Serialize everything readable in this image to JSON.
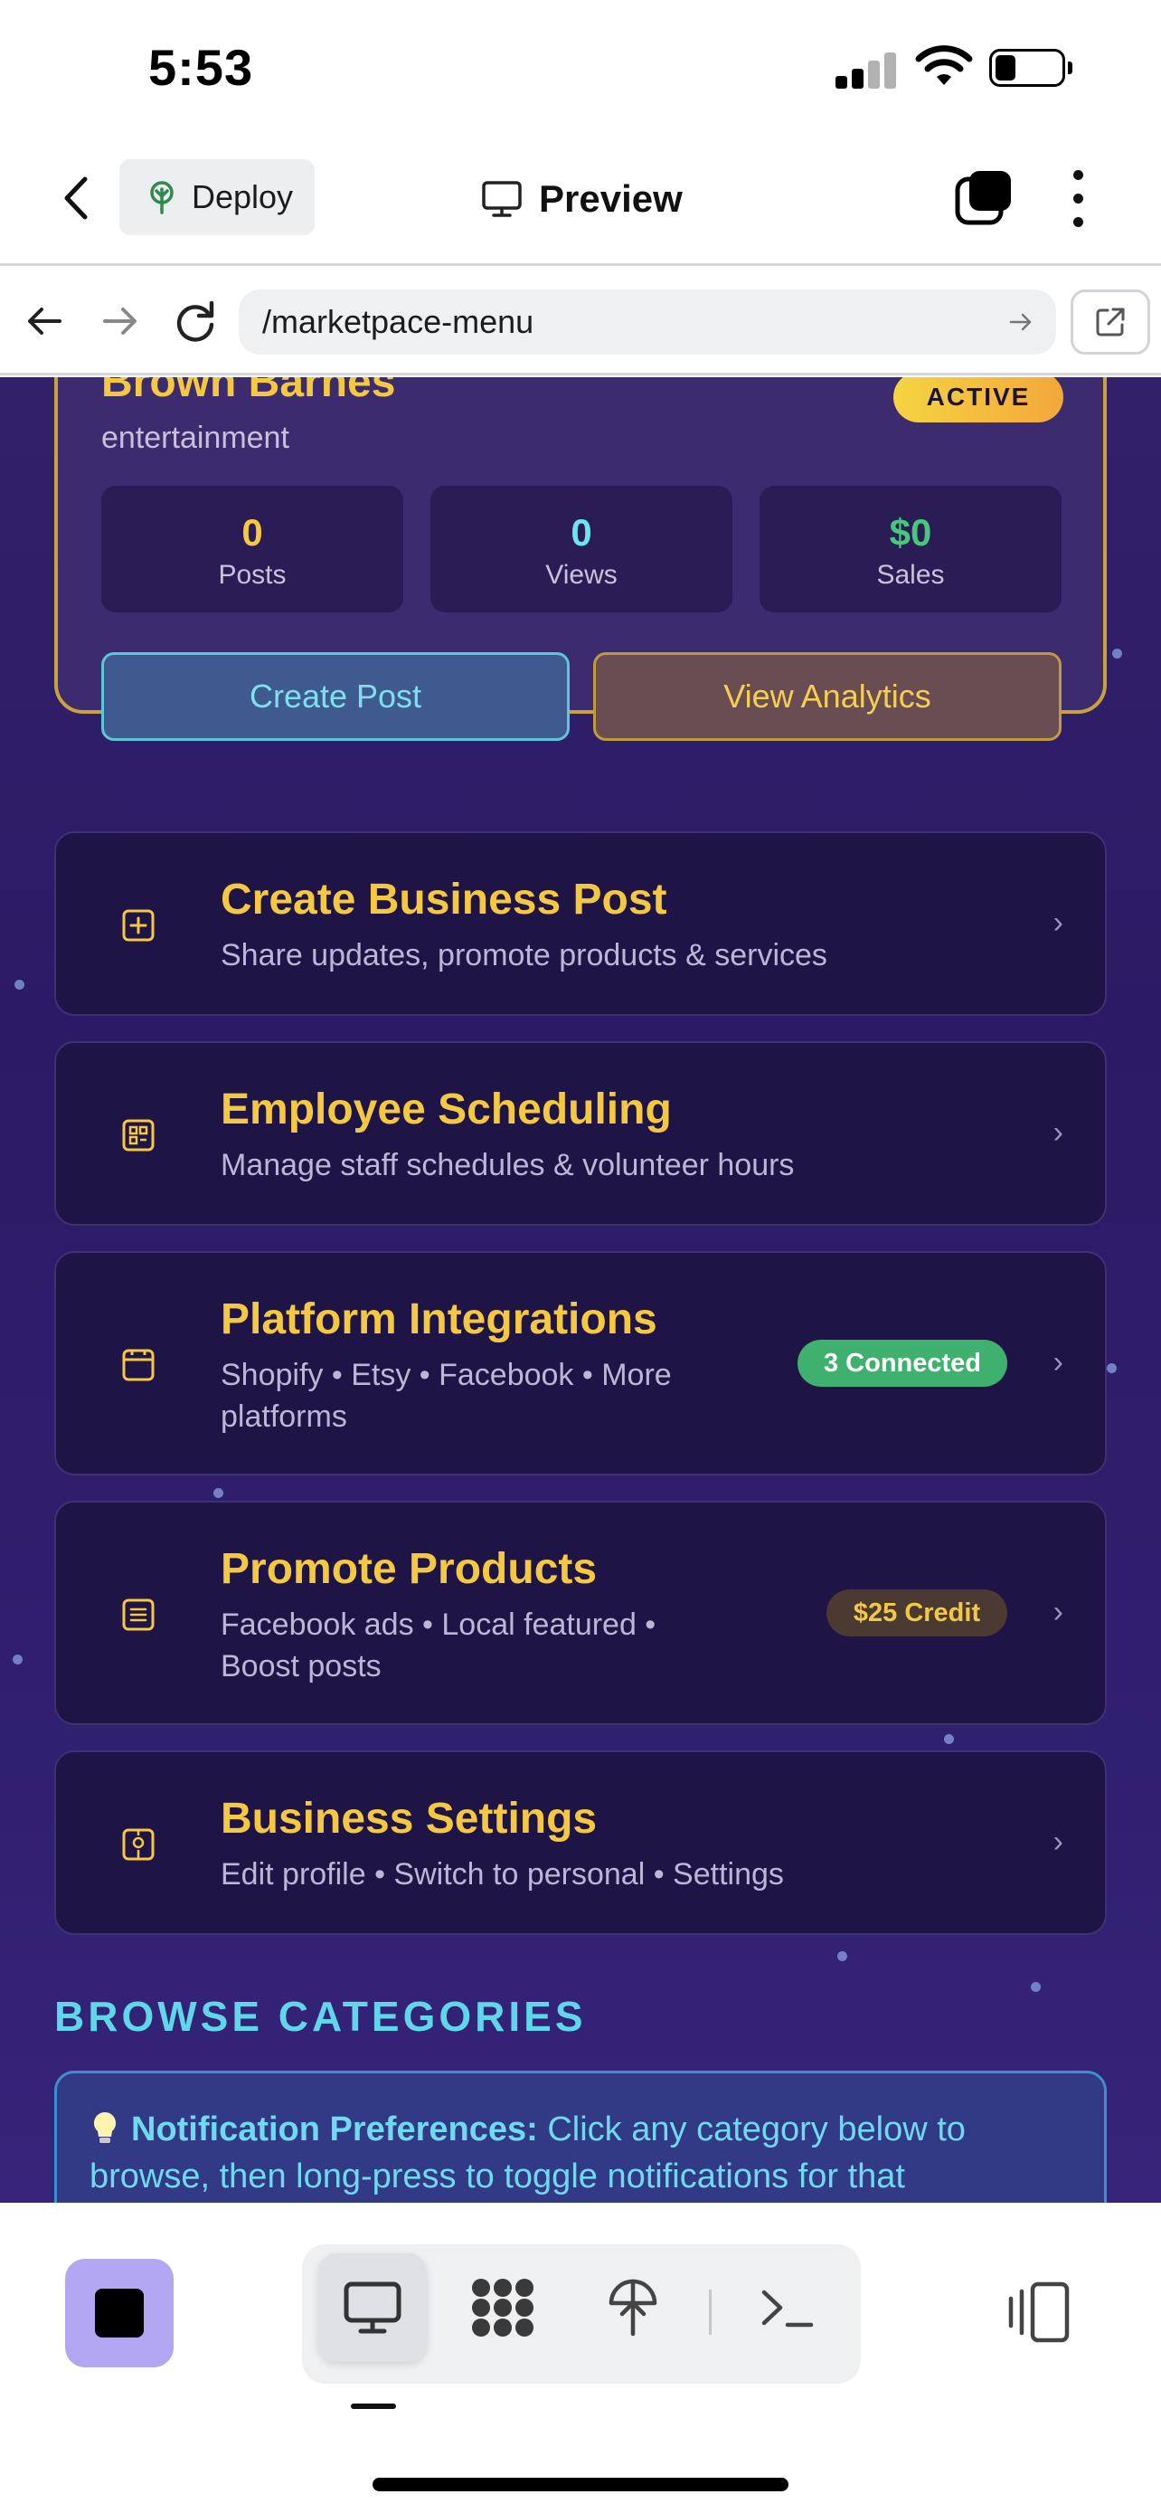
{
  "status_bar": {
    "time": "5:53"
  },
  "header": {
    "deploy_label": "Deploy",
    "preview_label": "Preview"
  },
  "browser": {
    "url": "/marketpace-menu"
  },
  "business_card": {
    "name": "Brown Barnes",
    "category": "entertainment",
    "status": "ACTIVE",
    "stats": [
      {
        "value": "0",
        "label": "Posts",
        "color": "#f5c842"
      },
      {
        "value": "0",
        "label": "Views",
        "color": "#6fe3f2"
      },
      {
        "value": "$0",
        "label": "Sales",
        "color": "#48c77a"
      }
    ],
    "create_post_label": "Create Post",
    "view_analytics_label": "View Analytics"
  },
  "menu": {
    "items": [
      {
        "title": "Create Business Post",
        "subtitle": "Share updates, promote products & services",
        "icon": "plus-square-icon"
      },
      {
        "title": "Employee Scheduling",
        "subtitle": "Manage staff schedules & volunteer hours",
        "icon": "grid-icon"
      },
      {
        "title": "Platform Integrations",
        "subtitle": "Shopify • Etsy • Facebook • More platforms",
        "icon": "window-icon",
        "badge": "3 Connected"
      },
      {
        "title": "Promote Products",
        "subtitle": "Facebook ads • Local featured • Boost posts",
        "icon": "list-icon",
        "badge": "$25 Credit"
      },
      {
        "title": "Business Settings",
        "subtitle": "Edit profile • Switch to personal • Settings",
        "icon": "settings-icon"
      }
    ]
  },
  "browse": {
    "title": "BROWSE CATEGORIES",
    "notice_icon": "lightbulb-icon",
    "notice_bold": "Notification Preferences:",
    "notice_text": " Click any category below to browse, then long-press to toggle notifications for that"
  },
  "colors": {
    "accent_gold": "#f5c842",
    "accent_cyan": "#5fd6ea",
    "background_purple": "#2b1b66",
    "stop_button": "#b3a6f2"
  }
}
